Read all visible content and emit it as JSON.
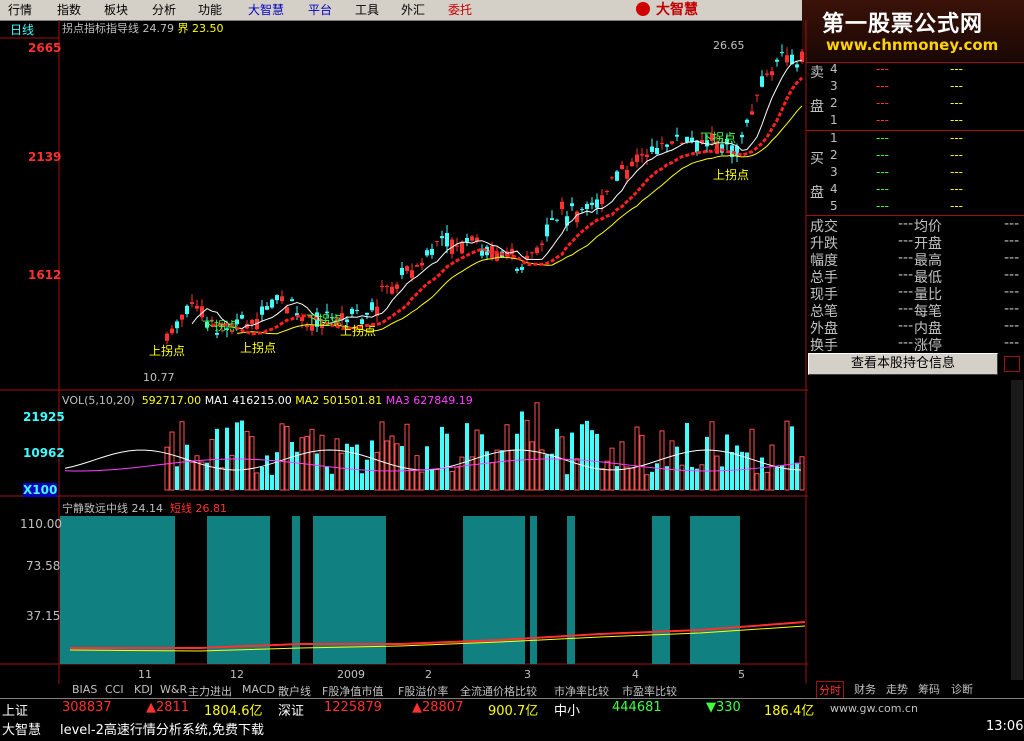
{
  "menu": [
    "行情",
    "指数",
    "板块",
    "分析",
    "功能",
    "大智慧",
    "平台",
    "工具",
    "外汇",
    "委托"
  ],
  "brand": "大智慧",
  "promo": {
    "line1": "第一股票公式网",
    "line2": "www.chnmoney.com"
  },
  "chart": {
    "period_label": "日线",
    "indicator_title": "拐点指标指导线",
    "indicator_v1": "24.79",
    "indicator_name2": "界",
    "indicator_v2": "23.50",
    "price_ticks": [
      "2665",
      "2139",
      "1612"
    ],
    "high_label": "26.65",
    "low_label": "10.77",
    "turn_up": "上拐点",
    "turn_down": "下拐点",
    "vol_header": {
      "name": "VOL(5,10,20)",
      "v": "592717.00",
      "ma1_l": "MA1",
      "ma1": "416215.00",
      "ma2_l": "MA2",
      "ma2": "501501.81",
      "ma3_l": "MA3",
      "ma3": "627849.19"
    },
    "vol_ticks": [
      "21925",
      "10962",
      "X100"
    ],
    "ind2_header": {
      "name": "宁静致远中线",
      "v1": "24.14",
      "n2": "短线",
      "v2": "26.81"
    },
    "ind2_ticks": [
      "110.00",
      "73.58",
      "37.15"
    ],
    "x_labels": [
      "11",
      "12",
      "2009",
      "2",
      "3",
      "4",
      "5"
    ]
  },
  "order_book": {
    "sell_label": [
      "卖",
      "盘"
    ],
    "buy_label": [
      "买",
      "盘"
    ],
    "sell_levels": [
      "4",
      "3",
      "2",
      "1"
    ],
    "buy_levels": [
      "1",
      "2",
      "3",
      "4",
      "5"
    ],
    "placeholder": "---"
  },
  "stats": [
    {
      "l": "成交",
      "r": "均价"
    },
    {
      "l": "升跌",
      "r": "开盘"
    },
    {
      "l": "幅度",
      "r": "最高"
    },
    {
      "l": "总手",
      "r": "最低"
    },
    {
      "l": "现手",
      "r": "量比"
    },
    {
      "l": "总笔",
      "r": "每笔"
    },
    {
      "l": "外盘",
      "r": "内盘"
    },
    {
      "l": "换手",
      "r": "涨停"
    }
  ],
  "holding_button": "查看本股持仓信息",
  "right_tabs": [
    "分时",
    "财务",
    "走势",
    "筹码",
    "诊断"
  ],
  "bottom_tabs": [
    "BIAS",
    "CCI",
    "KDJ",
    "W&R",
    "主力进出",
    "MACD",
    "散户线",
    "F股净值市值",
    "F股溢价率",
    "全流通价格比较",
    "市净率比较",
    "市盈率比较"
  ],
  "status": {
    "sh_label": "上证",
    "sh_val": "308837",
    "sh_up": "▲2811",
    "sh_amt": "1804.6亿",
    "sz_label": "深证",
    "sz_val": "1225879",
    "sz_up": "▲28807",
    "sz_amt": "900.7亿",
    "zx_label": "中小",
    "zx_val": "444681",
    "zx_dn": "▼330",
    "zx_amt": "186.4亿",
    "site": "www.gw.com.cn",
    "brand2": "大智慧",
    "ticker": "level-2高速行情分析系统,免费下载",
    "time": "13:06"
  },
  "colors": {
    "up": "#ff3030",
    "down": "#40ffff",
    "ma_white": "#ffffff",
    "ma_yellow": "#ffff00",
    "ma_magenta": "#ff40ff",
    "bar": "#108080"
  }
}
